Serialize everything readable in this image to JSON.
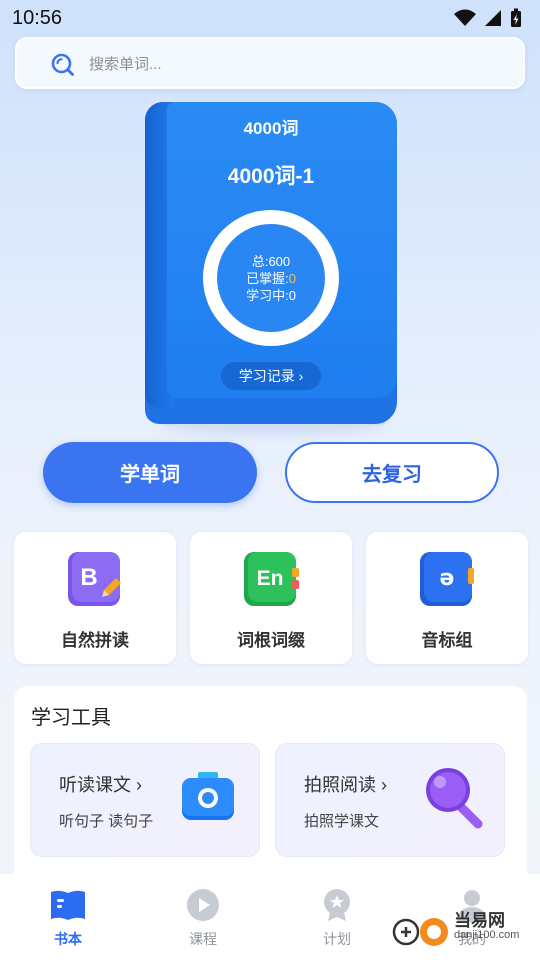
{
  "status": {
    "time": "10:56"
  },
  "search": {
    "placeholder": "搜索单词..."
  },
  "book": {
    "title": "4000词",
    "subtitle": "4000词-1",
    "total": "总:600",
    "mastered_label": "已掌握:",
    "mastered_value": "0",
    "learning": "学习中:0",
    "record_label": "学习记录 ›"
  },
  "actions": {
    "learn": "学单词",
    "review": "去复习"
  },
  "features": [
    {
      "label": "自然拼读",
      "icon_letter": "B"
    },
    {
      "label": "词根词缀",
      "icon_letter": "En"
    },
    {
      "label": "音标组",
      "icon_letter": "ə"
    }
  ],
  "tools": {
    "title": "学习工具",
    "items": [
      {
        "title": "听读课文 ›",
        "desc": "听句子 读句子"
      },
      {
        "title": "拍照阅读 ›",
        "desc": "拍照学课文"
      }
    ]
  },
  "nav": {
    "items": [
      {
        "label": "书本"
      },
      {
        "label": "课程"
      },
      {
        "label": "计划"
      },
      {
        "label": "我的"
      }
    ]
  },
  "watermark": {
    "line1": "当易网",
    "line2": "danji100.com"
  },
  "colors": {
    "accent": "#3a74f0",
    "book": "#1f7ef0",
    "mastered_highlight": "#f7c35a"
  }
}
